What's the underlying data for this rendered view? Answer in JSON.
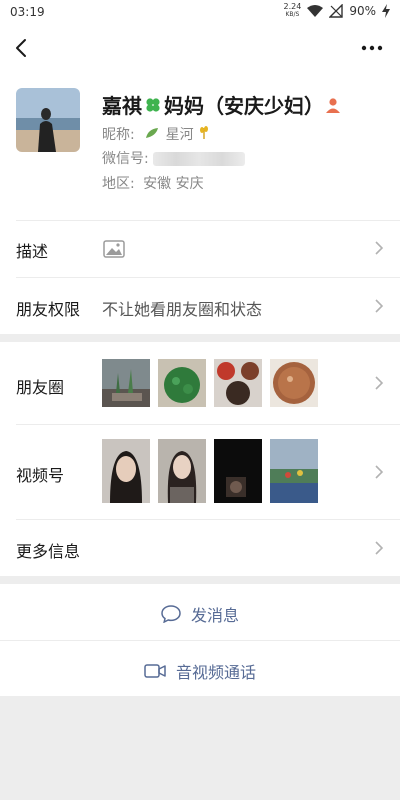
{
  "status": {
    "time": "03:19",
    "speed_value": "2.24",
    "speed_unit": "KB/S",
    "battery": "90%"
  },
  "profile": {
    "name_prefix": "嘉祺",
    "name_suffix": "妈妈（安庆少妇）",
    "nickname_label": "昵称:",
    "nickname_value": "星河",
    "wechat_id_label": "微信号:",
    "wechat_id_value": "",
    "region_label": "地区:",
    "region_value": "安徽  安庆"
  },
  "rows": {
    "description_label": "描述",
    "permission_label": "朋友权限",
    "permission_value": "不让她看朋友圈和状态",
    "moments_label": "朋友圈",
    "channels_label": "视频号",
    "more_label": "更多信息"
  },
  "actions": {
    "message_label": "发消息",
    "call_label": "音视频通话"
  },
  "colors": {
    "link": "#576b95",
    "clover": "#3fb34f",
    "person_icon": "#e8704f"
  }
}
